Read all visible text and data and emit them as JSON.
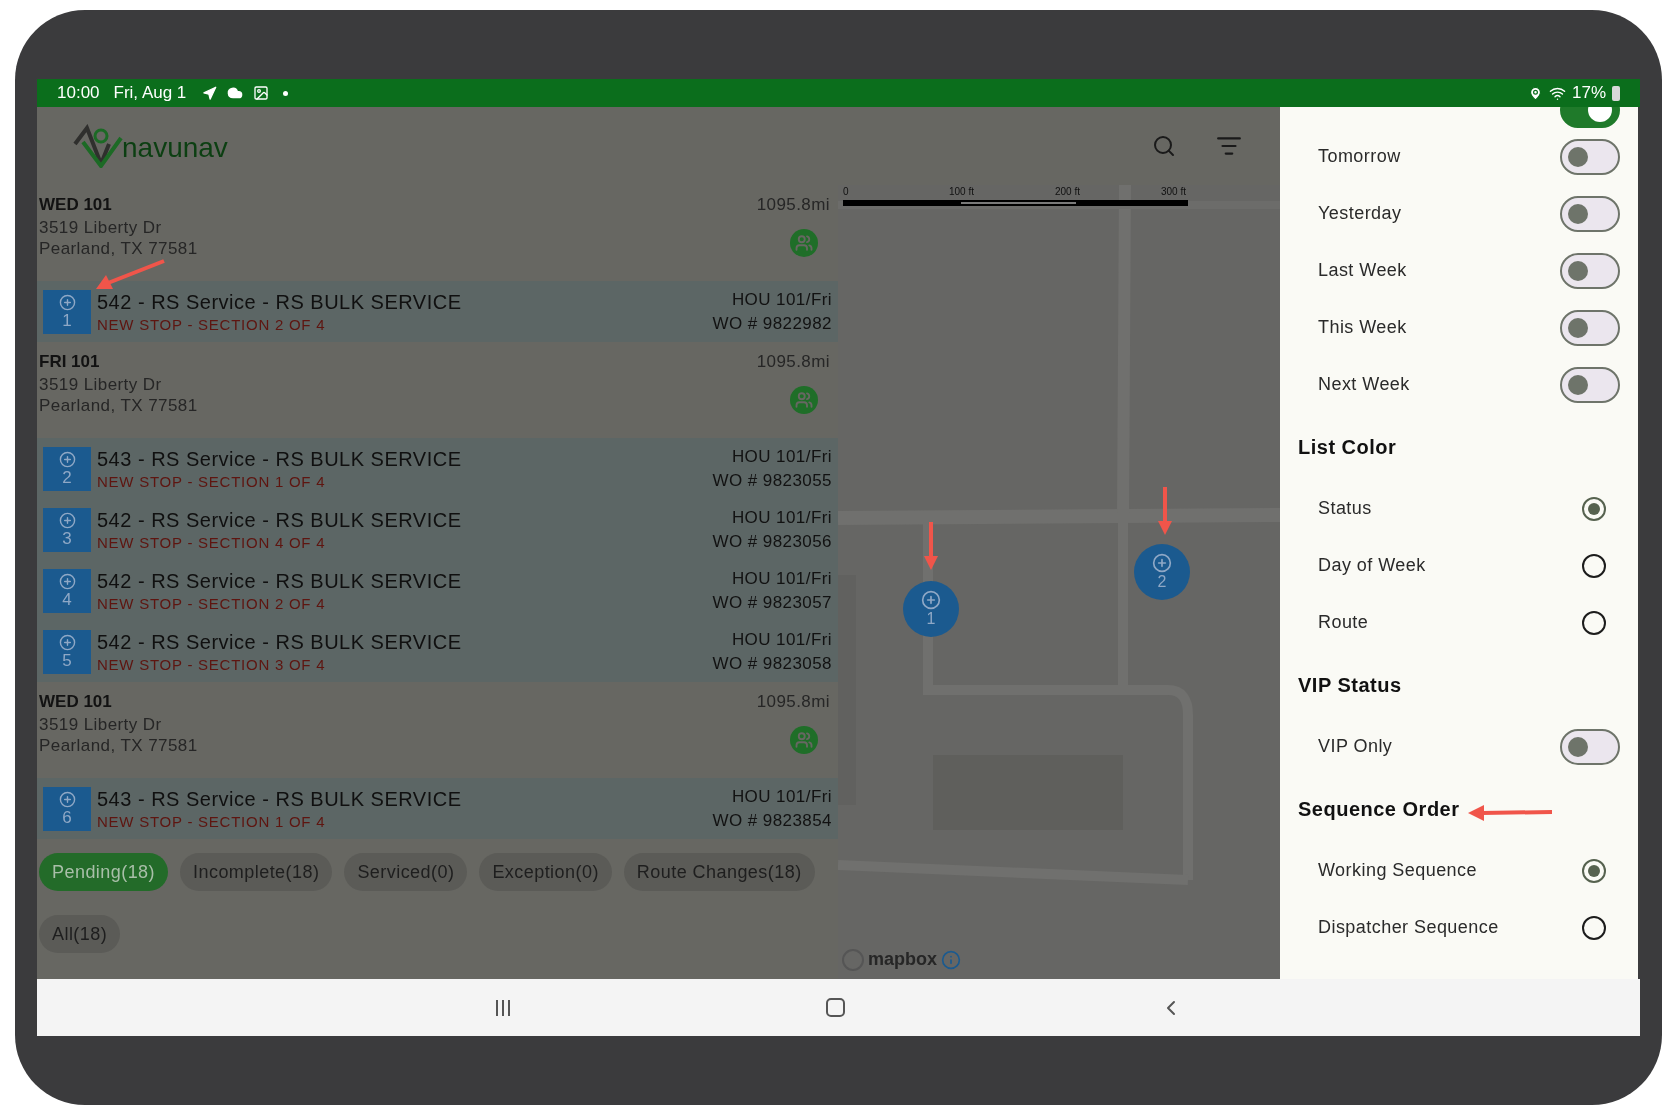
{
  "status_bar": {
    "time": "10:00",
    "date": "Fri, Aug 1",
    "battery": "17%"
  },
  "header": {
    "logo_text": "navunav"
  },
  "list": [
    {
      "kind": "group",
      "title": "WED 101",
      "distance": "1095.8mi",
      "address": [
        "3519 Liberty Dr",
        "Pearland, TX 77581"
      ]
    },
    {
      "kind": "stop",
      "number": "1",
      "title": "542 - RS Service - RS BULK SERVICE",
      "subtitle": "NEW STOP - SECTION 2 OF 4",
      "route": "HOU 101/Fri",
      "wo": "WO # 9822982"
    },
    {
      "kind": "group",
      "title": "FRI 101",
      "distance": "1095.8mi",
      "address": [
        "3519 Liberty Dr",
        "Pearland, TX 77581"
      ]
    },
    {
      "kind": "stop",
      "number": "2",
      "title": "543 - RS Service - RS BULK SERVICE",
      "subtitle": "NEW STOP - SECTION 1 OF 4",
      "route": "HOU 101/Fri",
      "wo": "WO # 9823055"
    },
    {
      "kind": "stop",
      "number": "3",
      "title": "542 - RS Service - RS BULK SERVICE",
      "subtitle": "NEW STOP - SECTION 4 OF 4",
      "route": "HOU 101/Fri",
      "wo": "WO # 9823056"
    },
    {
      "kind": "stop",
      "number": "4",
      "title": "542 - RS Service - RS BULK SERVICE",
      "subtitle": "NEW STOP - SECTION 2 OF 4",
      "route": "HOU 101/Fri",
      "wo": "WO # 9823057"
    },
    {
      "kind": "stop",
      "number": "5",
      "title": "542 - RS Service - RS BULK SERVICE",
      "subtitle": "NEW STOP - SECTION 3 OF 4",
      "route": "HOU 101/Fri",
      "wo": "WO # 9823058"
    },
    {
      "kind": "group",
      "title": "WED 101",
      "distance": "1095.8mi",
      "address": [
        "3519 Liberty Dr",
        "Pearland, TX 77581"
      ]
    },
    {
      "kind": "stop",
      "number": "6",
      "title": "543 - RS Service - RS BULK SERVICE",
      "subtitle": "NEW STOP - SECTION 1 OF 4",
      "route": "HOU 101/Fri",
      "wo": "WO # 9823854"
    }
  ],
  "filter_chips": [
    {
      "label": "Pending(18)",
      "selected": true
    },
    {
      "label": "Incomplete(18)",
      "selected": false
    },
    {
      "label": "Serviced(0)",
      "selected": false
    },
    {
      "label": "Exception(0)",
      "selected": false
    },
    {
      "label": "Route Changes(18)",
      "selected": false
    },
    {
      "label": "All(18)",
      "selected": false
    }
  ],
  "map": {
    "scale_labels": [
      "0",
      "100 ft",
      "200 ft",
      "300 ft"
    ],
    "attribution": "mapbox",
    "markers": [
      {
        "number": "1"
      },
      {
        "number": "2"
      }
    ]
  },
  "drawer": {
    "top_switch": {
      "on": true
    },
    "sections": [
      {
        "items": [
          {
            "kind": "toggle",
            "label": "Tomorrow",
            "on": false
          },
          {
            "kind": "toggle",
            "label": "Yesterday",
            "on": false
          },
          {
            "kind": "toggle",
            "label": "Last Week",
            "on": false
          },
          {
            "kind": "toggle",
            "label": "This Week",
            "on": false
          },
          {
            "kind": "toggle",
            "label": "Next Week",
            "on": false
          }
        ]
      },
      {
        "heading": "List Color",
        "items": [
          {
            "kind": "radio",
            "label": "Status",
            "selected": true
          },
          {
            "kind": "radio",
            "label": "Day of Week",
            "selected": false
          },
          {
            "kind": "radio",
            "label": "Route",
            "selected": false
          }
        ]
      },
      {
        "heading": "VIP Status",
        "items": [
          {
            "kind": "toggle",
            "label": "VIP Only",
            "on": false
          }
        ]
      },
      {
        "heading": "Sequence Order",
        "items": [
          {
            "kind": "radio",
            "label": "Working Sequence",
            "selected": true
          },
          {
            "kind": "radio",
            "label": "Dispatcher Sequence",
            "selected": false
          }
        ]
      }
    ]
  }
}
